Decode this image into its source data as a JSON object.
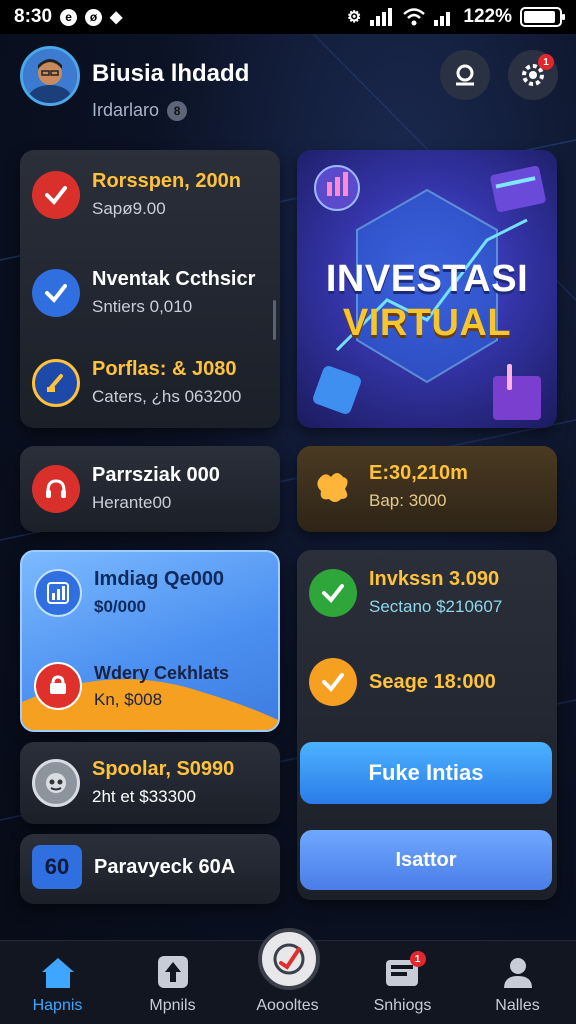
{
  "status_bar": {
    "time": "8:30",
    "battery_text": "122%",
    "battery_level": 0.9
  },
  "header": {
    "user_name": "Biusia lhdadd",
    "user_sub": "Irdarlaro",
    "sub_badge": "8",
    "settings_badge": "1"
  },
  "left_card": {
    "items": [
      {
        "title": "Rorsspen, 200n",
        "subtitle": "Sapø9.00",
        "title_color": "#ffc23a",
        "icon_bg": "#d9302c",
        "icon": "check-heart-icon"
      },
      {
        "title": "Nventak Ccthsicr",
        "subtitle": "Sntiers 0,010",
        "title_color": "#ffffff",
        "icon_bg": "#2f6fe0",
        "icon": "check-icon"
      },
      {
        "title": "Porflas: & J080",
        "subtitle": "Caters, ¿hs 063200",
        "title_color": "#ffc23a",
        "icon_bg": "#1d4aa8",
        "icon": "brush-icon"
      }
    ]
  },
  "card_parrsziak": {
    "title": "Parrsziak 000",
    "subtitle": "Herante00",
    "icon_bg": "#d9302c"
  },
  "banner": {
    "line1": "INVESTASI",
    "line2": "VIRTUAL"
  },
  "card_gold": {
    "title": "E:30,210m",
    "subtitle": "Bap: 3000"
  },
  "card_blue": {
    "item1": {
      "title": "Imdiag Qe000",
      "subtitle": "$0/000"
    },
    "item2": {
      "title": "Wdery Cekhlats",
      "subtitle": "Kn, $008"
    }
  },
  "card_spoolar": {
    "title": "Spoolar, S0990",
    "subtitle": "2ht et $33300"
  },
  "card_parayecl": {
    "title": "Paravyeck 60A",
    "icon_text": "60"
  },
  "right_card": {
    "item1": {
      "title": "Invkssn 3.090",
      "subtitle": "Sectano $210607"
    },
    "item2": {
      "title": "Seage 18:000"
    }
  },
  "buttons": {
    "primary": "Fuke Intias",
    "secondary": "Isattor"
  },
  "bottom_nav": [
    {
      "label": "Hapnis",
      "icon": "home-icon",
      "active": true
    },
    {
      "label": "Mpnils",
      "icon": "upload-icon",
      "active": false
    },
    {
      "label": "Aoooltes",
      "icon": "pen-icon",
      "active": false
    },
    {
      "label": "Snhiogs",
      "icon": "inbox-icon",
      "badge": "1",
      "active": false
    },
    {
      "label": "Nalles",
      "icon": "profile-icon",
      "active": false
    }
  ],
  "colors": {
    "accent_blue": "#3fa6ff",
    "gold": "#ffc23a",
    "banner_purple": "#3434a8"
  }
}
